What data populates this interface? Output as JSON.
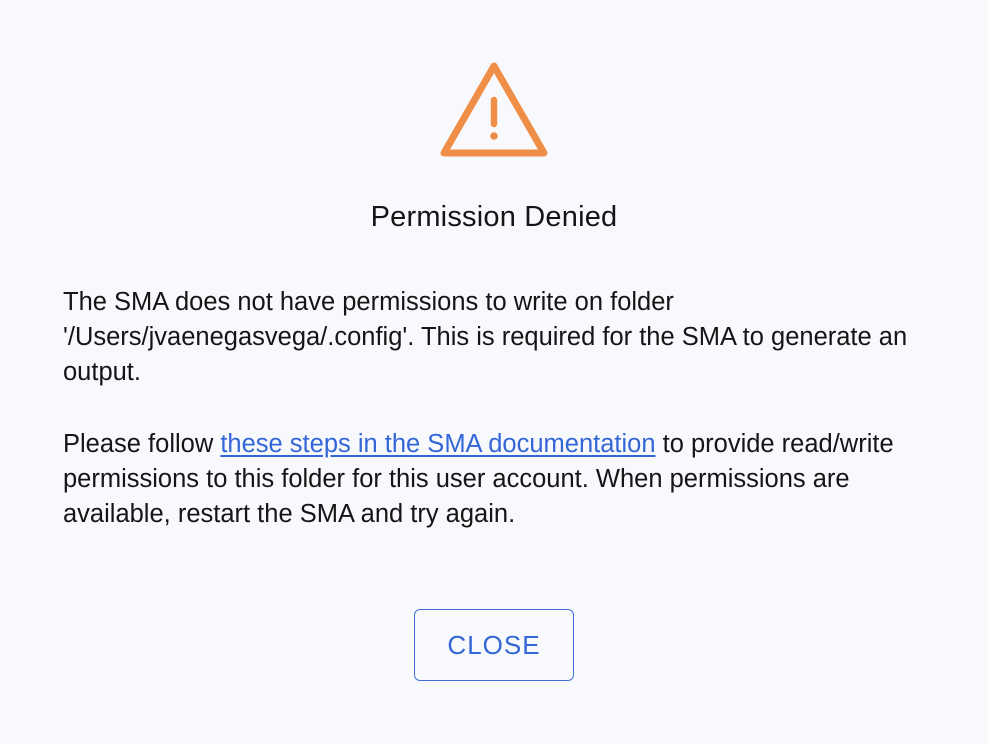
{
  "dialog": {
    "icon": "warning-triangle-icon",
    "icon_color": "#ef8e46",
    "title": "Permission Denied",
    "paragraph_1": "The SMA does not have permissions to write on folder '/Users/jvaenegasvega/.config'. This is required for the SMA to generate an output.",
    "paragraph_2_before_link": "Please follow ",
    "paragraph_2_link": "these steps in the SMA documentation",
    "paragraph_2_after_link": " to provide read/write permissions to this folder for this user account. When permissions are available, restart the SMA and try again.",
    "close_label": "CLOSE",
    "link_color": "#3366d6",
    "background_color": "#f8f9fd"
  }
}
